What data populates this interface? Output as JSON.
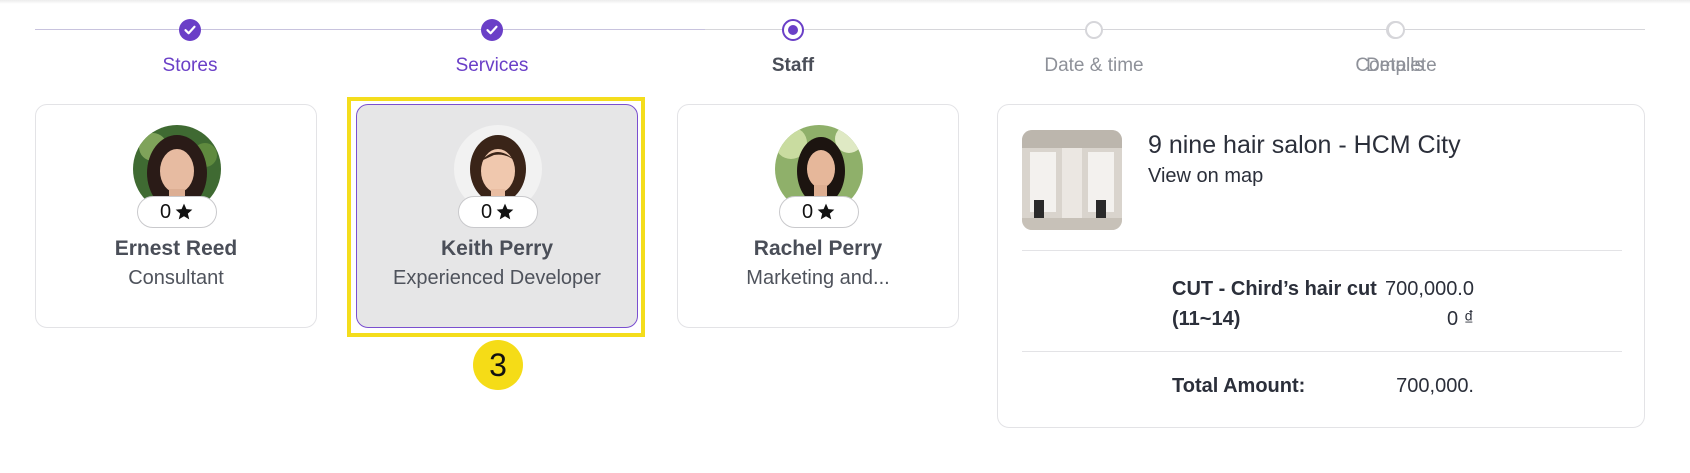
{
  "steps": [
    {
      "label": "Stores",
      "state": "done"
    },
    {
      "label": "Services",
      "state": "done"
    },
    {
      "label": "Staff",
      "state": "current"
    },
    {
      "label": "Date & time",
      "state": "todo"
    },
    {
      "label": "Details",
      "state": "todo"
    },
    {
      "label": "Complete",
      "state": "todo"
    }
  ],
  "staff": [
    {
      "name": "Ernest Reed",
      "role": "Consultant",
      "rating": "0",
      "selected": false
    },
    {
      "name": "Keith Perry",
      "role": "Experienced Developer",
      "rating": "0",
      "selected": true
    },
    {
      "name": "Rachel Perry",
      "role": "Marketing and...",
      "rating": "0",
      "selected": false
    }
  ],
  "marker_number": "3",
  "summary": {
    "store_name": "9 nine hair salon - HCM City",
    "map_link": "View on map",
    "service_name": "CUT - Chird’s hair cut (11~14)",
    "service_price": "700,000.00 ₫",
    "total_label": "Total Amount:",
    "total_value": "700,000."
  },
  "colors": {
    "accent": "#6a3fc7",
    "highlight": "#f4dd1c",
    "selected_card": "#e6e6e7"
  }
}
